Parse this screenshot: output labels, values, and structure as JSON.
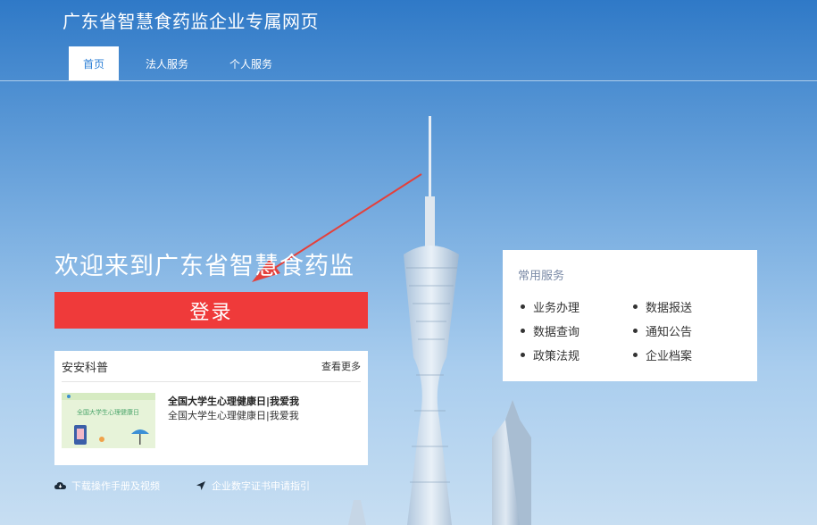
{
  "header": {
    "title": "广东省智慧食药监企业专属网页"
  },
  "nav": {
    "tabs": [
      {
        "label": "首页"
      },
      {
        "label": "法人服务"
      },
      {
        "label": "个人服务"
      }
    ]
  },
  "hero": {
    "welcome": "欢迎来到广东省智慧食药监",
    "login_label": "登录"
  },
  "news": {
    "title": "安安科普",
    "more_label": "查看更多",
    "item": {
      "title": "全国大学生心理健康日|我爱我",
      "subtitle": "全国大学生心理健康日|我爱我",
      "thumb_text": "全国大学生心理健康日"
    }
  },
  "links": {
    "download": "下载操作手册及视频",
    "certificate": "企业数字证书申请指引"
  },
  "services": {
    "title": "常用服务",
    "items": [
      "业务办理",
      "数据报送",
      "数据查询",
      "通知公告",
      "政策法规",
      "企业档案"
    ]
  },
  "colors": {
    "accent": "#2c7fd6",
    "login": "#ef3a3a"
  }
}
